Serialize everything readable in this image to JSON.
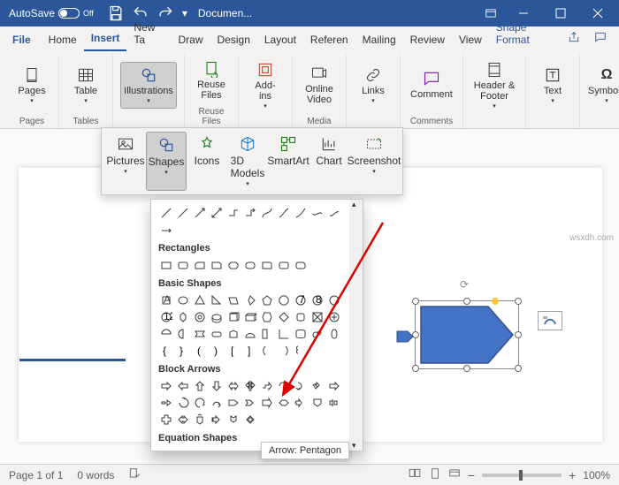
{
  "title_bar": {
    "autosave": "AutoSave",
    "off": "Off",
    "doc_name": "Documen..."
  },
  "tabs": [
    "File",
    "Home",
    "Insert",
    "New Ta",
    "Draw",
    "Design",
    "Layout",
    "Referen",
    "Mailing",
    "Review",
    "View",
    "Shape Format"
  ],
  "ribbon_groups": {
    "pages": "Pages",
    "tables": "Tables",
    "table": "Table",
    "illustrations": "Illustrations",
    "reuse_group": "Reuse Files",
    "reuse": "Reuse\nFiles",
    "addins": "Add-\nins",
    "media": "Media",
    "online_video": "Online\nVideo",
    "links": "Links",
    "comments": "Comments",
    "comment": "Comment",
    "hf_group": "Header & Footer",
    "hf": "Header &\nFooter",
    "text": "Text",
    "symbols": "Symbols"
  },
  "subribbon": {
    "pictures": "Pictures",
    "shapes": "Shapes",
    "icons": "Icons",
    "models": "3D\nModels",
    "smartart": "SmartArt",
    "chart": "Chart",
    "screenshot": "Screenshot"
  },
  "dropdown": {
    "rectangles": "Rectangles",
    "basic": "Basic Shapes",
    "block": "Block Arrows",
    "equation": "Equation Shapes"
  },
  "tooltip": "Arrow: Pentagon",
  "status": {
    "page": "Page 1 of 1",
    "words": "0 words",
    "zoom": "100%"
  }
}
